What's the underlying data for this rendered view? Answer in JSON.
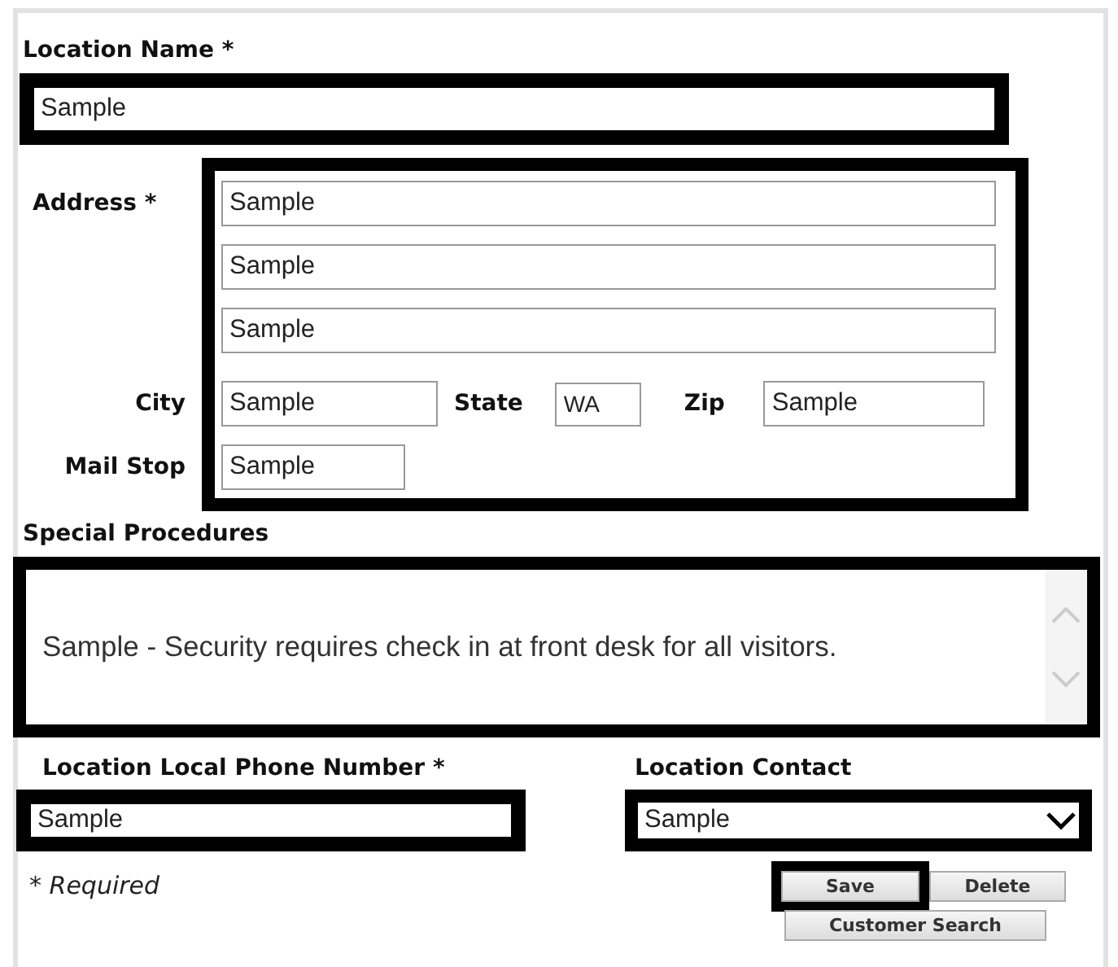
{
  "location_name": {
    "label": "Location Name *",
    "value": "Sample",
    "highlighted": true
  },
  "address": {
    "label": "Address *",
    "highlighted": true,
    "lines": [
      {
        "value": "Sample"
      },
      {
        "value": "Sample"
      },
      {
        "value": "Sample"
      }
    ],
    "city": {
      "label": "City",
      "value": "Sample"
    },
    "state": {
      "label": "State",
      "value": "WA"
    },
    "zip": {
      "label": "Zip",
      "value": "Sample"
    },
    "mail_stop": {
      "label": "Mail Stop",
      "value": "Sample"
    }
  },
  "special_procedures": {
    "label": "Special Procedures",
    "value": "Sample - Security requires check in at front desk for all visitors.",
    "highlighted": true
  },
  "phone": {
    "label": "Location Local Phone Number *",
    "value": "Sample",
    "highlighted": true
  },
  "contact": {
    "label": "Location Contact",
    "value": "Sample",
    "highlighted": true
  },
  "required_note": "* Required",
  "button_rows": [
    {
      "buttons": [
        {
          "label": "Save",
          "highlighted": true
        },
        {
          "label": "Delete",
          "highlighted": false
        }
      ]
    },
    {
      "buttons": [
        {
          "label": "Customer Search",
          "highlighted": false
        }
      ]
    }
  ]
}
